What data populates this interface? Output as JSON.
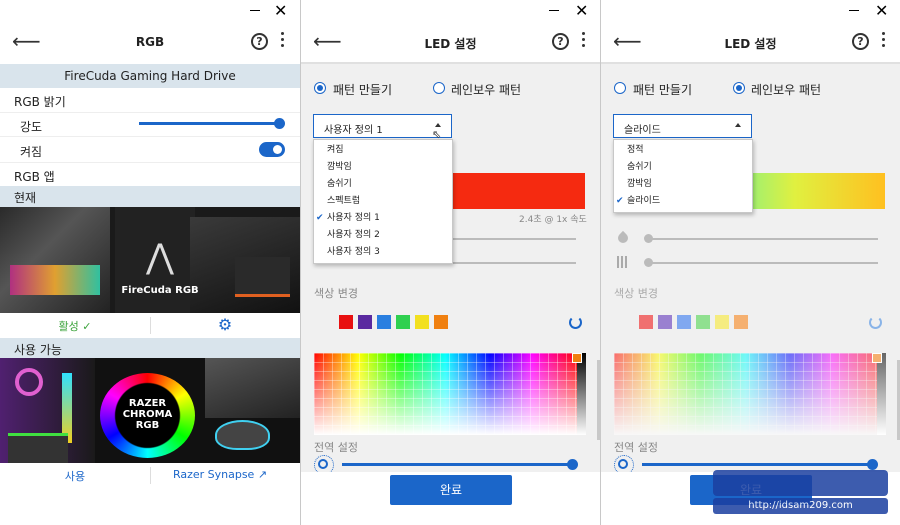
{
  "panel1": {
    "title": "RGB",
    "device_name": "FireCuda Gaming Hard Drive",
    "brightness_label": "RGB 밝기",
    "intensity_label": "강도",
    "intensity_value": 1.0,
    "on_label": "켜짐",
    "on_state": true,
    "rgb_app_label": "RGB 앱",
    "current_label": "현재",
    "firecuda_image_text": "FireCuda RGB",
    "active_label": "활성 ✓",
    "available_label": "사용 가능",
    "razer_image_text": "RAZER CHROMA RGB",
    "use_label": "사용",
    "razer_link": "Razer Synapse"
  },
  "panel2": {
    "title": "LED 설정",
    "radio_custom": "패턴 만들기",
    "radio_rainbow": "레인보우 패턴",
    "select_value": "사용자 정의 1",
    "dropdown": [
      "켜짐",
      "깜박임",
      "숨쉬기",
      "스펙트럼",
      "사용자 정의 1",
      "사용자 정의 2",
      "사용자 정의 3"
    ],
    "dropdown_selected": "사용자 정의 1",
    "speed_text": "2.4초 @ 1x 속도",
    "color_change_label": "색상 변경",
    "swatches": [
      "#e81010",
      "#5a2aa0",
      "#2a7fe0",
      "#2fd050",
      "#f2e020",
      "#f08010"
    ],
    "global_label": "전역 설정",
    "done_label": "완료",
    "preview_color": "#f52a10"
  },
  "panel3": {
    "title": "LED 설정",
    "radio_custom": "패턴 만들기",
    "radio_rainbow": "레인보우 패턴",
    "select_value": "슬라이드",
    "dropdown": [
      "정적",
      "숨쉬기",
      "깜박임",
      "슬라이드"
    ],
    "dropdown_selected": "슬라이드",
    "color_change_label": "색상 변경",
    "swatches": [
      "#f07070",
      "#9a80d0",
      "#80a8f0",
      "#90e090",
      "#f5ec80",
      "#f5b070"
    ],
    "global_label": "전역 설정",
    "done_label": "완료"
  },
  "watermark": "http://idsam209.com"
}
